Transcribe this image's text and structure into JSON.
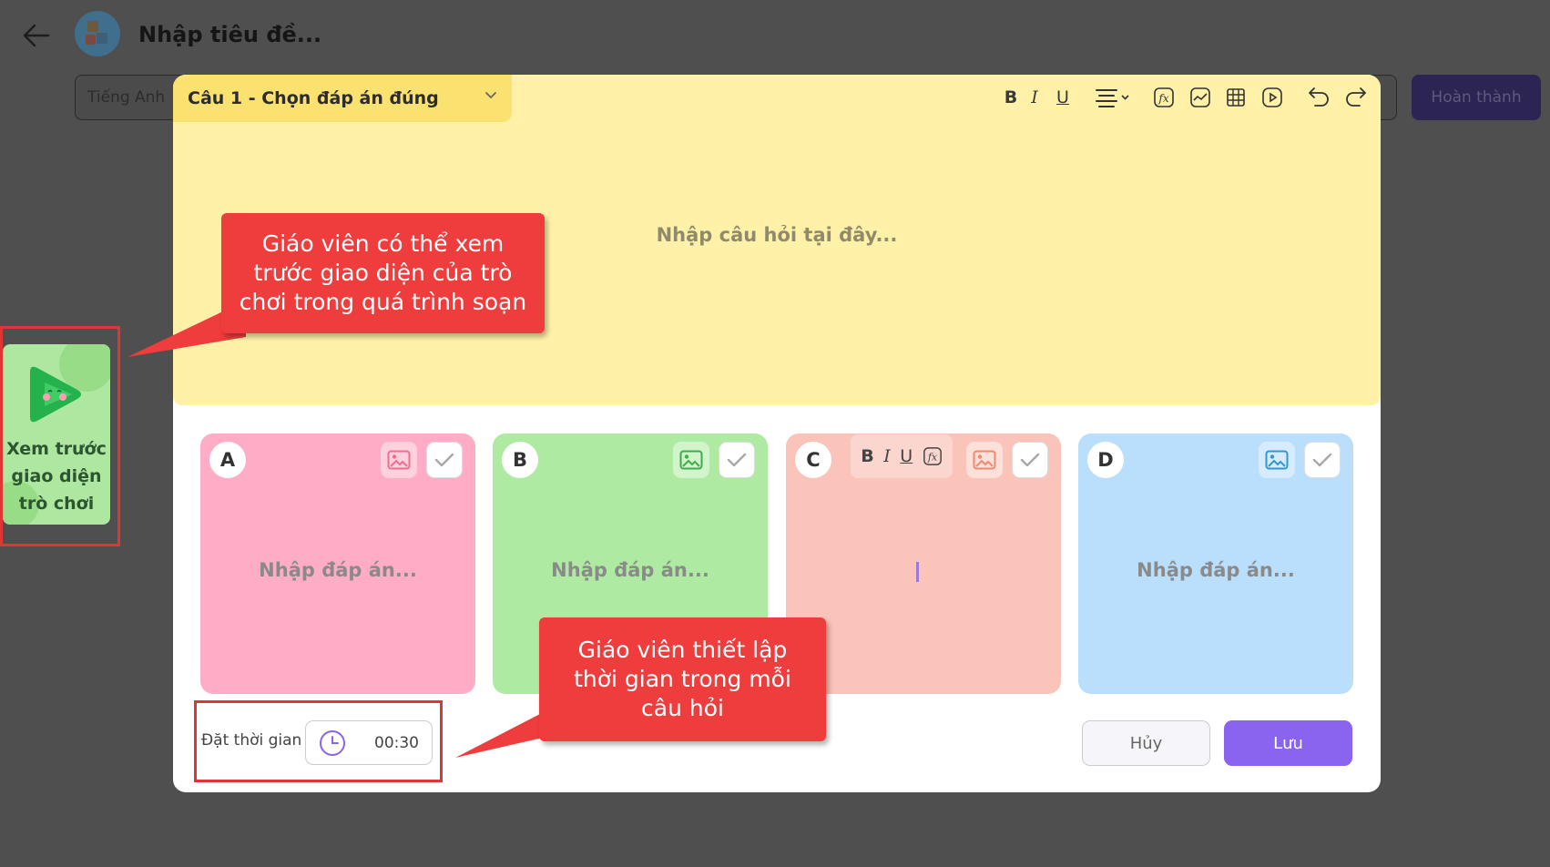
{
  "header": {
    "title": "Nhập tiêu đề...",
    "language": "Tiếng Anh",
    "done_label": "Hoàn thành"
  },
  "question": {
    "type_label": "Câu 1 - Chọn đáp án đúng",
    "placeholder": "Nhập câu hỏi tại đây...",
    "toolbar": {
      "bold": "B",
      "italic": "I",
      "underline": "U"
    }
  },
  "answers": [
    {
      "letter": "A",
      "placeholder": "Nhập đáp án...",
      "color": "#ffadc6",
      "img_bg": "#ffd0de",
      "img_color": "#ee6f8f"
    },
    {
      "letter": "B",
      "placeholder": "Nhập đáp án...",
      "color": "#afeaa2",
      "img_bg": "#d2f4cb",
      "img_color": "#3dae4d"
    },
    {
      "letter": "C",
      "placeholder": "",
      "color": "#fac4ba",
      "img_bg": "#fde0d9",
      "img_color": "#f1896f"
    },
    {
      "letter": "D",
      "placeholder": "Nhập đáp án...",
      "color": "#b9dffd",
      "img_bg": "#d6ecfe",
      "img_color": "#2f97d1"
    }
  ],
  "answer_format": {
    "bold": "B",
    "italic": "I",
    "underline": "U"
  },
  "timer": {
    "label": "Đặt thời gian",
    "value": "00:30"
  },
  "actions": {
    "cancel": "Hủy",
    "save": "Lưu"
  },
  "preview": {
    "label": "Xem trước giao diện trò chơi"
  },
  "callouts": {
    "preview": "Giáo viên có thể xem trước giao diện của trò chơi trong quá trình soạn",
    "timer": "Giáo viên thiết lập thời gian trong mỗi câu hỏi"
  },
  "colors": {
    "accent": "#8a63ee",
    "question_bg": "#fff2a8",
    "callout": "#ef3c3c"
  }
}
